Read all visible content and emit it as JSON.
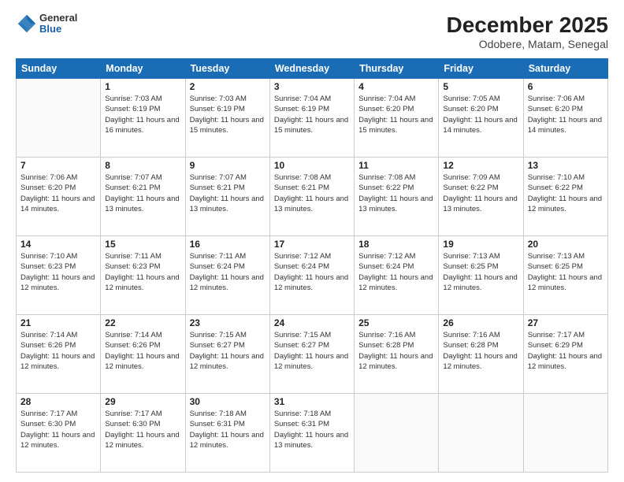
{
  "header": {
    "logo_line1": "General",
    "logo_line2": "Blue",
    "title": "December 2025",
    "subtitle": "Odobere, Matam, Senegal"
  },
  "calendar": {
    "days_of_week": [
      "Sunday",
      "Monday",
      "Tuesday",
      "Wednesday",
      "Thursday",
      "Friday",
      "Saturday"
    ],
    "weeks": [
      [
        {
          "day": "",
          "sunrise": "",
          "sunset": "",
          "daylight": ""
        },
        {
          "day": "1",
          "sunrise": "Sunrise: 7:03 AM",
          "sunset": "Sunset: 6:19 PM",
          "daylight": "Daylight: 11 hours and 16 minutes."
        },
        {
          "day": "2",
          "sunrise": "Sunrise: 7:03 AM",
          "sunset": "Sunset: 6:19 PM",
          "daylight": "Daylight: 11 hours and 15 minutes."
        },
        {
          "day": "3",
          "sunrise": "Sunrise: 7:04 AM",
          "sunset": "Sunset: 6:19 PM",
          "daylight": "Daylight: 11 hours and 15 minutes."
        },
        {
          "day": "4",
          "sunrise": "Sunrise: 7:04 AM",
          "sunset": "Sunset: 6:20 PM",
          "daylight": "Daylight: 11 hours and 15 minutes."
        },
        {
          "day": "5",
          "sunrise": "Sunrise: 7:05 AM",
          "sunset": "Sunset: 6:20 PM",
          "daylight": "Daylight: 11 hours and 14 minutes."
        },
        {
          "day": "6",
          "sunrise": "Sunrise: 7:06 AM",
          "sunset": "Sunset: 6:20 PM",
          "daylight": "Daylight: 11 hours and 14 minutes."
        }
      ],
      [
        {
          "day": "7",
          "sunrise": "Sunrise: 7:06 AM",
          "sunset": "Sunset: 6:20 PM",
          "daylight": "Daylight: 11 hours and 14 minutes."
        },
        {
          "day": "8",
          "sunrise": "Sunrise: 7:07 AM",
          "sunset": "Sunset: 6:21 PM",
          "daylight": "Daylight: 11 hours and 13 minutes."
        },
        {
          "day": "9",
          "sunrise": "Sunrise: 7:07 AM",
          "sunset": "Sunset: 6:21 PM",
          "daylight": "Daylight: 11 hours and 13 minutes."
        },
        {
          "day": "10",
          "sunrise": "Sunrise: 7:08 AM",
          "sunset": "Sunset: 6:21 PM",
          "daylight": "Daylight: 11 hours and 13 minutes."
        },
        {
          "day": "11",
          "sunrise": "Sunrise: 7:08 AM",
          "sunset": "Sunset: 6:22 PM",
          "daylight": "Daylight: 11 hours and 13 minutes."
        },
        {
          "day": "12",
          "sunrise": "Sunrise: 7:09 AM",
          "sunset": "Sunset: 6:22 PM",
          "daylight": "Daylight: 11 hours and 13 minutes."
        },
        {
          "day": "13",
          "sunrise": "Sunrise: 7:10 AM",
          "sunset": "Sunset: 6:22 PM",
          "daylight": "Daylight: 11 hours and 12 minutes."
        }
      ],
      [
        {
          "day": "14",
          "sunrise": "Sunrise: 7:10 AM",
          "sunset": "Sunset: 6:23 PM",
          "daylight": "Daylight: 11 hours and 12 minutes."
        },
        {
          "day": "15",
          "sunrise": "Sunrise: 7:11 AM",
          "sunset": "Sunset: 6:23 PM",
          "daylight": "Daylight: 11 hours and 12 minutes."
        },
        {
          "day": "16",
          "sunrise": "Sunrise: 7:11 AM",
          "sunset": "Sunset: 6:24 PM",
          "daylight": "Daylight: 11 hours and 12 minutes."
        },
        {
          "day": "17",
          "sunrise": "Sunrise: 7:12 AM",
          "sunset": "Sunset: 6:24 PM",
          "daylight": "Daylight: 11 hours and 12 minutes."
        },
        {
          "day": "18",
          "sunrise": "Sunrise: 7:12 AM",
          "sunset": "Sunset: 6:24 PM",
          "daylight": "Daylight: 11 hours and 12 minutes."
        },
        {
          "day": "19",
          "sunrise": "Sunrise: 7:13 AM",
          "sunset": "Sunset: 6:25 PM",
          "daylight": "Daylight: 11 hours and 12 minutes."
        },
        {
          "day": "20",
          "sunrise": "Sunrise: 7:13 AM",
          "sunset": "Sunset: 6:25 PM",
          "daylight": "Daylight: 11 hours and 12 minutes."
        }
      ],
      [
        {
          "day": "21",
          "sunrise": "Sunrise: 7:14 AM",
          "sunset": "Sunset: 6:26 PM",
          "daylight": "Daylight: 11 hours and 12 minutes."
        },
        {
          "day": "22",
          "sunrise": "Sunrise: 7:14 AM",
          "sunset": "Sunset: 6:26 PM",
          "daylight": "Daylight: 11 hours and 12 minutes."
        },
        {
          "day": "23",
          "sunrise": "Sunrise: 7:15 AM",
          "sunset": "Sunset: 6:27 PM",
          "daylight": "Daylight: 11 hours and 12 minutes."
        },
        {
          "day": "24",
          "sunrise": "Sunrise: 7:15 AM",
          "sunset": "Sunset: 6:27 PM",
          "daylight": "Daylight: 11 hours and 12 minutes."
        },
        {
          "day": "25",
          "sunrise": "Sunrise: 7:16 AM",
          "sunset": "Sunset: 6:28 PM",
          "daylight": "Daylight: 11 hours and 12 minutes."
        },
        {
          "day": "26",
          "sunrise": "Sunrise: 7:16 AM",
          "sunset": "Sunset: 6:28 PM",
          "daylight": "Daylight: 11 hours and 12 minutes."
        },
        {
          "day": "27",
          "sunrise": "Sunrise: 7:17 AM",
          "sunset": "Sunset: 6:29 PM",
          "daylight": "Daylight: 11 hours and 12 minutes."
        }
      ],
      [
        {
          "day": "28",
          "sunrise": "Sunrise: 7:17 AM",
          "sunset": "Sunset: 6:30 PM",
          "daylight": "Daylight: 11 hours and 12 minutes."
        },
        {
          "day": "29",
          "sunrise": "Sunrise: 7:17 AM",
          "sunset": "Sunset: 6:30 PM",
          "daylight": "Daylight: 11 hours and 12 minutes."
        },
        {
          "day": "30",
          "sunrise": "Sunrise: 7:18 AM",
          "sunset": "Sunset: 6:31 PM",
          "daylight": "Daylight: 11 hours and 12 minutes."
        },
        {
          "day": "31",
          "sunrise": "Sunrise: 7:18 AM",
          "sunset": "Sunset: 6:31 PM",
          "daylight": "Daylight: 11 hours and 13 minutes."
        },
        {
          "day": "",
          "sunrise": "",
          "sunset": "",
          "daylight": ""
        },
        {
          "day": "",
          "sunrise": "",
          "sunset": "",
          "daylight": ""
        },
        {
          "day": "",
          "sunrise": "",
          "sunset": "",
          "daylight": ""
        }
      ]
    ]
  }
}
